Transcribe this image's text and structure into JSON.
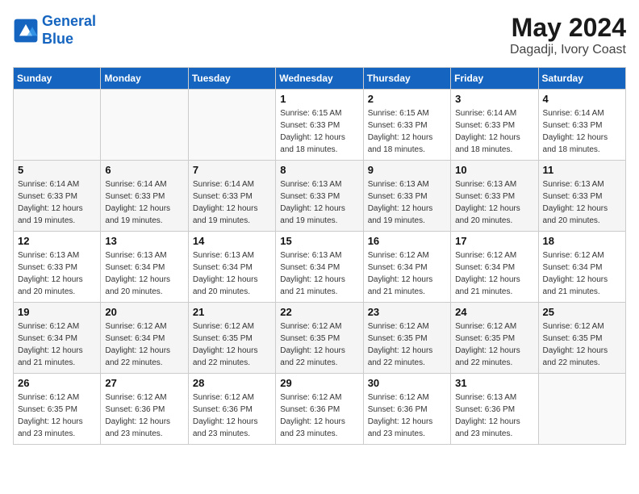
{
  "header": {
    "logo_line1": "General",
    "logo_line2": "Blue",
    "month": "May 2024",
    "location": "Dagadji, Ivory Coast"
  },
  "weekdays": [
    "Sunday",
    "Monday",
    "Tuesday",
    "Wednesday",
    "Thursday",
    "Friday",
    "Saturday"
  ],
  "weeks": [
    [
      {
        "day": "",
        "info": ""
      },
      {
        "day": "",
        "info": ""
      },
      {
        "day": "",
        "info": ""
      },
      {
        "day": "1",
        "info": "Sunrise: 6:15 AM\nSunset: 6:33 PM\nDaylight: 12 hours\nand 18 minutes."
      },
      {
        "day": "2",
        "info": "Sunrise: 6:15 AM\nSunset: 6:33 PM\nDaylight: 12 hours\nand 18 minutes."
      },
      {
        "day": "3",
        "info": "Sunrise: 6:14 AM\nSunset: 6:33 PM\nDaylight: 12 hours\nand 18 minutes."
      },
      {
        "day": "4",
        "info": "Sunrise: 6:14 AM\nSunset: 6:33 PM\nDaylight: 12 hours\nand 18 minutes."
      }
    ],
    [
      {
        "day": "5",
        "info": "Sunrise: 6:14 AM\nSunset: 6:33 PM\nDaylight: 12 hours\nand 19 minutes."
      },
      {
        "day": "6",
        "info": "Sunrise: 6:14 AM\nSunset: 6:33 PM\nDaylight: 12 hours\nand 19 minutes."
      },
      {
        "day": "7",
        "info": "Sunrise: 6:14 AM\nSunset: 6:33 PM\nDaylight: 12 hours\nand 19 minutes."
      },
      {
        "day": "8",
        "info": "Sunrise: 6:13 AM\nSunset: 6:33 PM\nDaylight: 12 hours\nand 19 minutes."
      },
      {
        "day": "9",
        "info": "Sunrise: 6:13 AM\nSunset: 6:33 PM\nDaylight: 12 hours\nand 19 minutes."
      },
      {
        "day": "10",
        "info": "Sunrise: 6:13 AM\nSunset: 6:33 PM\nDaylight: 12 hours\nand 20 minutes."
      },
      {
        "day": "11",
        "info": "Sunrise: 6:13 AM\nSunset: 6:33 PM\nDaylight: 12 hours\nand 20 minutes."
      }
    ],
    [
      {
        "day": "12",
        "info": "Sunrise: 6:13 AM\nSunset: 6:33 PM\nDaylight: 12 hours\nand 20 minutes."
      },
      {
        "day": "13",
        "info": "Sunrise: 6:13 AM\nSunset: 6:34 PM\nDaylight: 12 hours\nand 20 minutes."
      },
      {
        "day": "14",
        "info": "Sunrise: 6:13 AM\nSunset: 6:34 PM\nDaylight: 12 hours\nand 20 minutes."
      },
      {
        "day": "15",
        "info": "Sunrise: 6:13 AM\nSunset: 6:34 PM\nDaylight: 12 hours\nand 21 minutes."
      },
      {
        "day": "16",
        "info": "Sunrise: 6:12 AM\nSunset: 6:34 PM\nDaylight: 12 hours\nand 21 minutes."
      },
      {
        "day": "17",
        "info": "Sunrise: 6:12 AM\nSunset: 6:34 PM\nDaylight: 12 hours\nand 21 minutes."
      },
      {
        "day": "18",
        "info": "Sunrise: 6:12 AM\nSunset: 6:34 PM\nDaylight: 12 hours\nand 21 minutes."
      }
    ],
    [
      {
        "day": "19",
        "info": "Sunrise: 6:12 AM\nSunset: 6:34 PM\nDaylight: 12 hours\nand 21 minutes."
      },
      {
        "day": "20",
        "info": "Sunrise: 6:12 AM\nSunset: 6:34 PM\nDaylight: 12 hours\nand 22 minutes."
      },
      {
        "day": "21",
        "info": "Sunrise: 6:12 AM\nSunset: 6:35 PM\nDaylight: 12 hours\nand 22 minutes."
      },
      {
        "day": "22",
        "info": "Sunrise: 6:12 AM\nSunset: 6:35 PM\nDaylight: 12 hours\nand 22 minutes."
      },
      {
        "day": "23",
        "info": "Sunrise: 6:12 AM\nSunset: 6:35 PM\nDaylight: 12 hours\nand 22 minutes."
      },
      {
        "day": "24",
        "info": "Sunrise: 6:12 AM\nSunset: 6:35 PM\nDaylight: 12 hours\nand 22 minutes."
      },
      {
        "day": "25",
        "info": "Sunrise: 6:12 AM\nSunset: 6:35 PM\nDaylight: 12 hours\nand 22 minutes."
      }
    ],
    [
      {
        "day": "26",
        "info": "Sunrise: 6:12 AM\nSunset: 6:35 PM\nDaylight: 12 hours\nand 23 minutes."
      },
      {
        "day": "27",
        "info": "Sunrise: 6:12 AM\nSunset: 6:36 PM\nDaylight: 12 hours\nand 23 minutes."
      },
      {
        "day": "28",
        "info": "Sunrise: 6:12 AM\nSunset: 6:36 PM\nDaylight: 12 hours\nand 23 minutes."
      },
      {
        "day": "29",
        "info": "Sunrise: 6:12 AM\nSunset: 6:36 PM\nDaylight: 12 hours\nand 23 minutes."
      },
      {
        "day": "30",
        "info": "Sunrise: 6:12 AM\nSunset: 6:36 PM\nDaylight: 12 hours\nand 23 minutes."
      },
      {
        "day": "31",
        "info": "Sunrise: 6:13 AM\nSunset: 6:36 PM\nDaylight: 12 hours\nand 23 minutes."
      },
      {
        "day": "",
        "info": ""
      }
    ]
  ]
}
